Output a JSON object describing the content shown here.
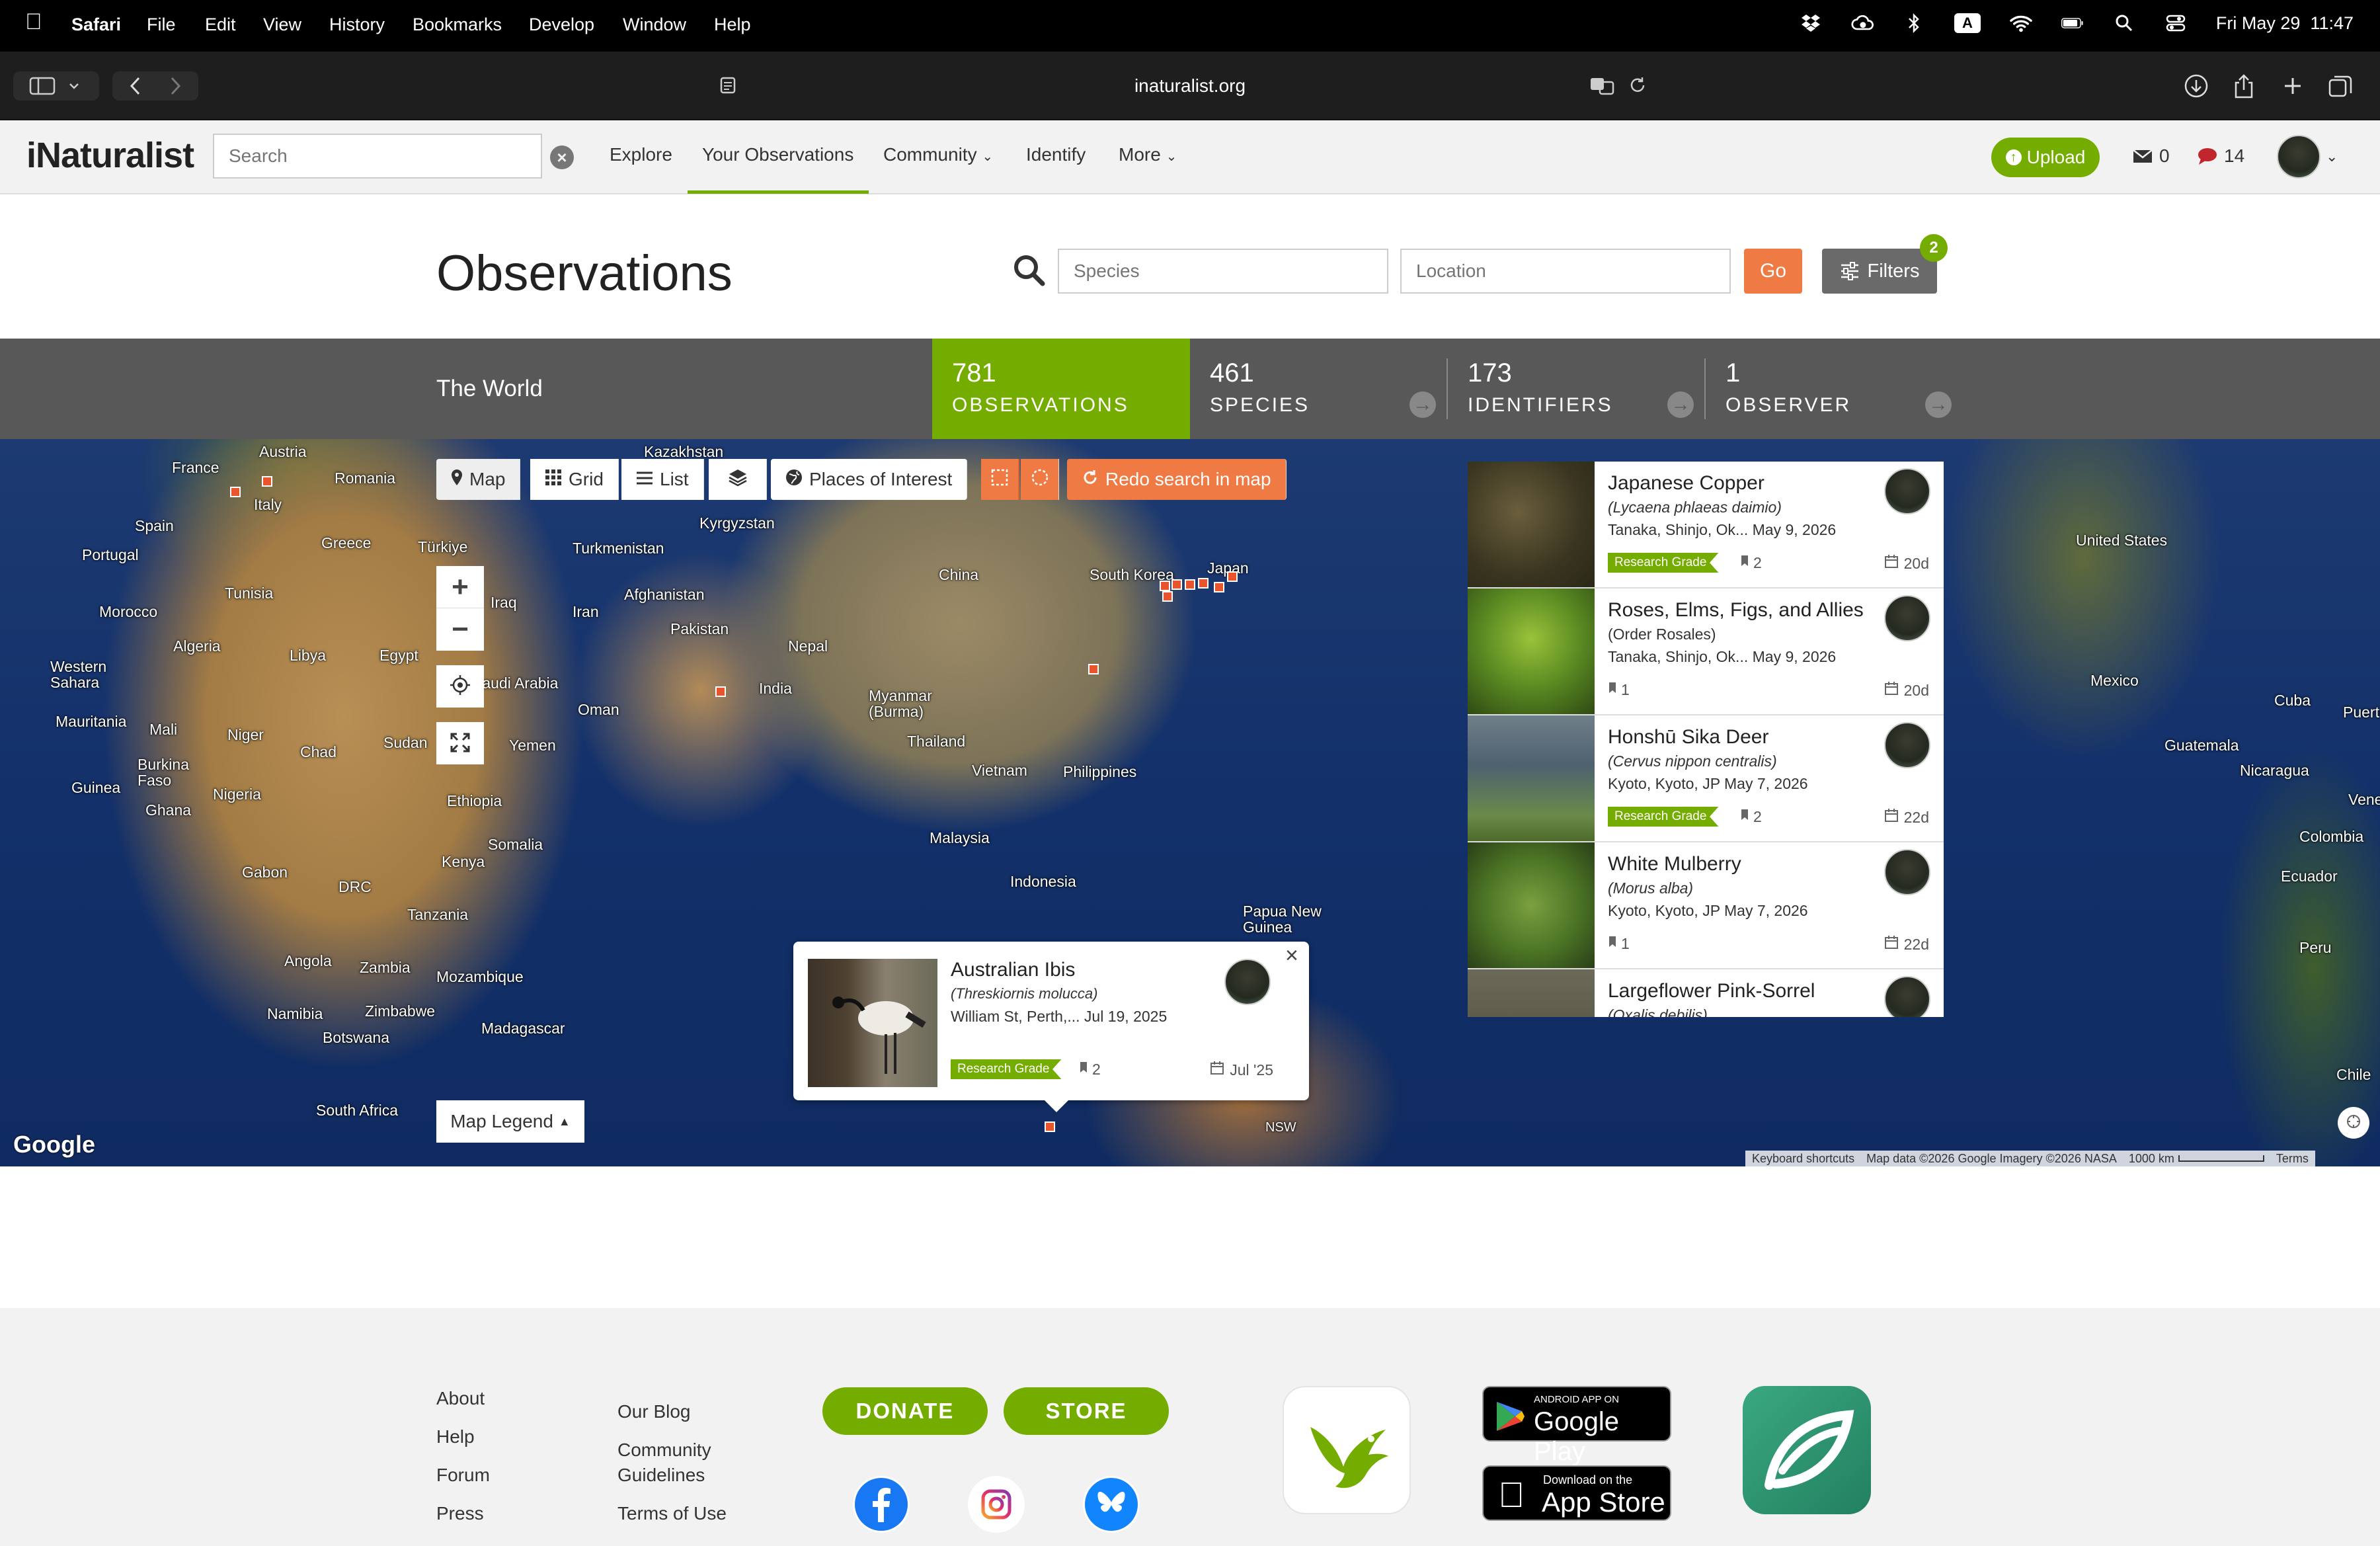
{
  "menubar": {
    "app": "Safari",
    "items": [
      "File",
      "Edit",
      "View",
      "History",
      "Bookmarks",
      "Develop",
      "Window",
      "Help"
    ],
    "datetime": "Fri May 29  11:47",
    "input_badge": "A"
  },
  "browser": {
    "url": "inaturalist.org"
  },
  "nav": {
    "logo": "iNaturalist",
    "search_placeholder": "Search",
    "links": {
      "explore": "Explore",
      "your_observations": "Your Observations",
      "community": "Community",
      "identify": "Identify",
      "more": "More"
    },
    "upload": "Upload",
    "messages_count": "0",
    "notifications_count": "14"
  },
  "header": {
    "title": "Observations",
    "species_placeholder": "Species",
    "location_placeholder": "Location",
    "go": "Go",
    "filters": "Filters",
    "filters_badge": "2"
  },
  "stats": {
    "place": "The World",
    "observations": {
      "num": "781",
      "label": "OBSERVATIONS"
    },
    "species": {
      "num": "461",
      "label": "SPECIES"
    },
    "identifiers": {
      "num": "173",
      "label": "IDENTIFIERS"
    },
    "observers": {
      "num": "1",
      "label": "OBSERVER"
    }
  },
  "map": {
    "controls": {
      "map": "Map",
      "grid": "Grid",
      "list": "List",
      "places": "Places of Interest",
      "redo": "Redo search in map"
    },
    "legend": "Map Legend",
    "google": "Google",
    "attribution": {
      "shortcuts": "Keyboard shortcuts",
      "data": "Map data ©2026 Google Imagery ©2026 NASA",
      "scale": "1000 km",
      "terms": "Terms"
    },
    "labels": [
      "France",
      "Austria",
      "Romania",
      "Kazakhstan",
      "Spain",
      "Italy",
      "Portugal",
      "Greece",
      "Türkiye",
      "Turkmenistan",
      "Kyrgyzstan",
      "Tunisia",
      "Morocco",
      "Iraq",
      "Iran",
      "Afghanistan",
      "China",
      "South Korea",
      "Japan",
      "Algeria",
      "Libya",
      "Egypt",
      "Pakistan",
      "Nepal",
      "Western Sahara",
      "Saudi Arabia",
      "India",
      "Myanmar (Burma)",
      "Mauritania",
      "Mali",
      "Niger",
      "Oman",
      "Chad",
      "Sudan",
      "Yemen",
      "Thailand",
      "Burkina Faso",
      "Nigeria",
      "Guinea",
      "Ghana",
      "Ethiopia",
      "Vietnam",
      "Philippines",
      "Somalia",
      "Kenya",
      "Malaysia",
      "Gabon",
      "DRC",
      "Indonesia",
      "Tanzania",
      "Papua New Guinea",
      "Angola",
      "Zambia",
      "Mozambique",
      "Namibia",
      "Zimbabwe",
      "Botswana",
      "Madagascar",
      "South Africa",
      "NSW",
      "United States",
      "Mexico",
      "Cuba",
      "Guatemala",
      "Nicaragua",
      "Colombia",
      "Ecuador",
      "Peru",
      "Chile",
      "Puerto",
      "Venezuela"
    ]
  },
  "popup": {
    "name": "Australian Ibis",
    "sci": "(Threskiornis molucca)",
    "location": "William St, Perth,... Jul 19, 2025",
    "grade": "Research Grade",
    "ids": "2",
    "date": "Jul '25"
  },
  "observations": [
    {
      "name": "Japanese Copper",
      "sci": "(Lycaena phlaeas daimio)",
      "location": "Tanaka, Shinjo, Ok... May 9, 2026",
      "grade": "Research Grade",
      "ids": "2",
      "age": "20d"
    },
    {
      "name": "Roses, Elms, Figs, and Allies",
      "sci": "(Order Rosales)",
      "location": "Tanaka, Shinjo, Ok... May 9, 2026",
      "grade": "",
      "ids": "1",
      "age": "20d"
    },
    {
      "name": "Honshū Sika Deer",
      "sci": "(Cervus nippon centralis)",
      "location": "Kyoto, Kyoto, JP May 7, 2026",
      "grade": "Research Grade",
      "ids": "2",
      "age": "22d"
    },
    {
      "name": "White Mulberry",
      "sci": "(Morus alba)",
      "location": "Kyoto, Kyoto, JP May 7, 2026",
      "grade": "",
      "ids": "1",
      "age": "22d"
    },
    {
      "name": "Largeflower Pink-Sorrel",
      "sci": "(Oxalis debilis)",
      "location": "",
      "grade": "",
      "ids": "",
      "age": ""
    }
  ],
  "footer": {
    "col1": [
      "About",
      "Help",
      "Forum",
      "Press"
    ],
    "col2": {
      "blog": "Our Blog",
      "guidelines_1": "Community",
      "guidelines_2": "Guidelines",
      "terms": "Terms of Use"
    },
    "donate": "DONATE",
    "store": "STORE",
    "google_play_small": "ANDROID APP ON",
    "google_play": "Google Play",
    "app_store_small": "Download on the",
    "app_store": "App Store"
  },
  "colors": {
    "brand_green": "#74ac00",
    "accent_orange": "#ef7a44",
    "stats_bg": "#585858",
    "obs_marker": "#e8542e"
  }
}
